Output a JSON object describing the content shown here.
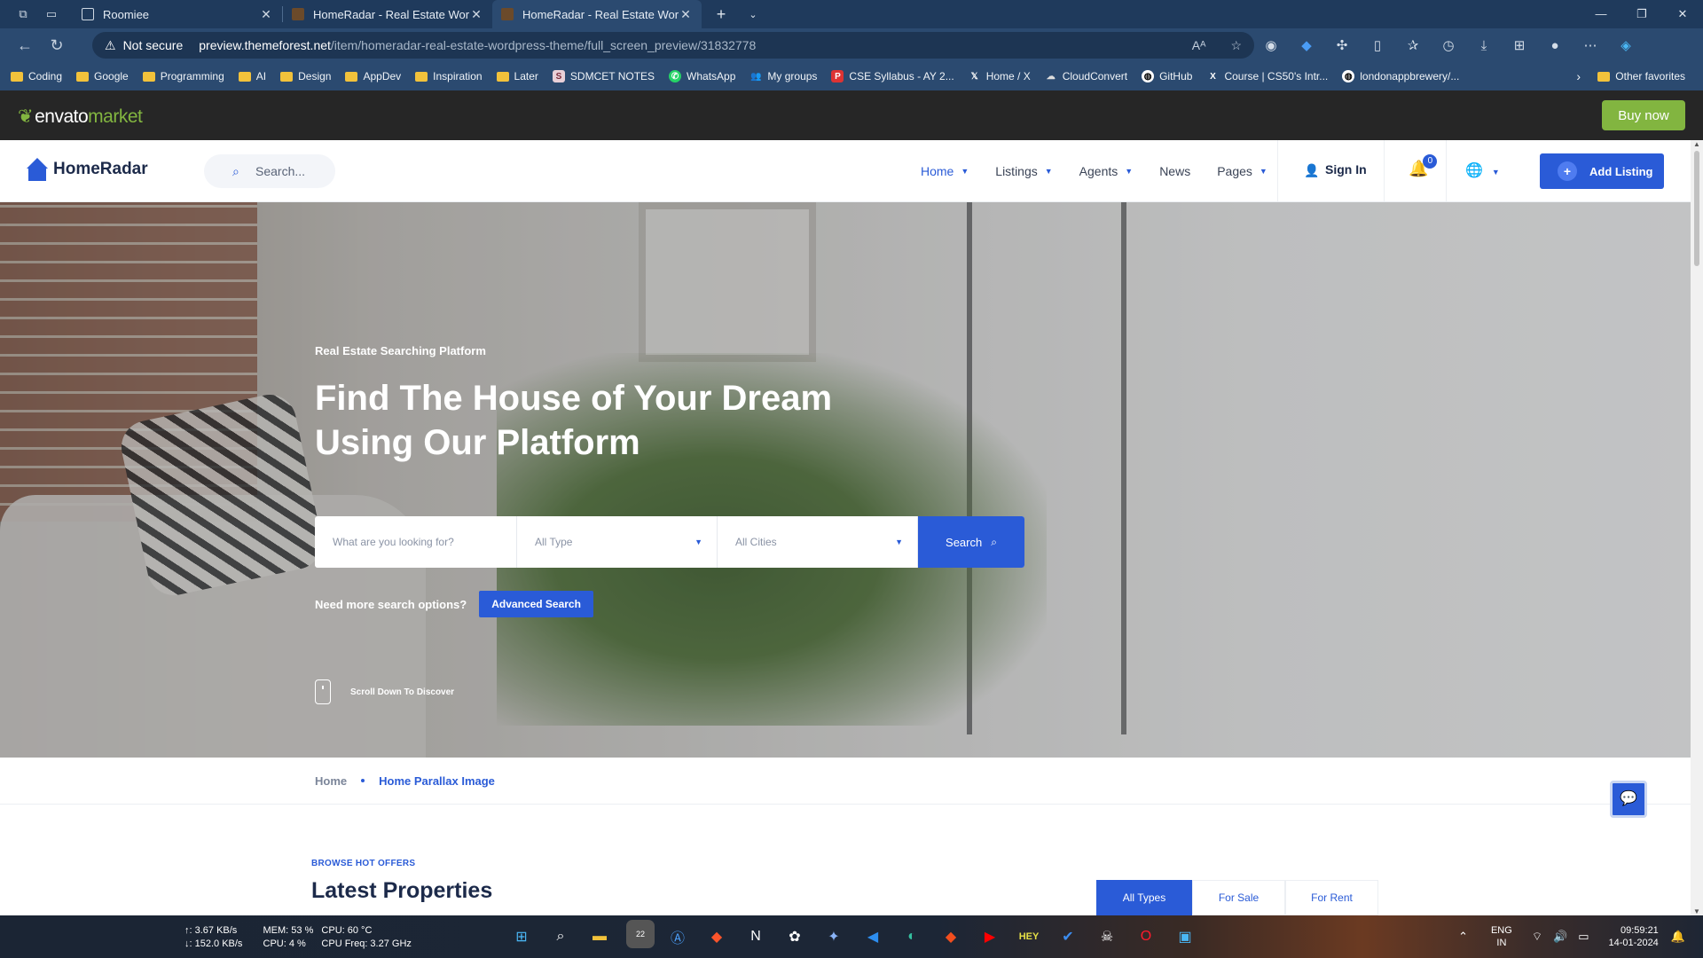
{
  "browser": {
    "tabs": [
      {
        "title": "Roomiee",
        "active": false
      },
      {
        "title": "HomeRadar - Real Estate WordPr",
        "active": false
      },
      {
        "title": "HomeRadar - Real Estate WordPr",
        "active": true
      }
    ],
    "address": {
      "security": "Not secure",
      "domain": "preview.themeforest.net",
      "path": "/item/homeradar-real-estate-wordpress-theme/full_screen_preview/31832778"
    },
    "bookmarks": [
      {
        "label": "Coding",
        "type": "folder"
      },
      {
        "label": "Google",
        "type": "folder"
      },
      {
        "label": "Programming",
        "type": "folder"
      },
      {
        "label": "AI",
        "type": "folder"
      },
      {
        "label": "Design",
        "type": "folder"
      },
      {
        "label": "AppDev",
        "type": "folder"
      },
      {
        "label": "Inspiration",
        "type": "folder"
      },
      {
        "label": "Later",
        "type": "folder"
      },
      {
        "label": "SDMCET NOTES",
        "type": "site"
      },
      {
        "label": "WhatsApp",
        "type": "site"
      },
      {
        "label": "My groups",
        "type": "site"
      },
      {
        "label": "CSE Syllabus - AY 2...",
        "type": "site"
      },
      {
        "label": "Home / X",
        "type": "site"
      },
      {
        "label": "CloudConvert",
        "type": "site"
      },
      {
        "label": "GitHub",
        "type": "site"
      },
      {
        "label": "Course | CS50's Intr...",
        "type": "site"
      },
      {
        "label": "londonappbrewery/...",
        "type": "site"
      }
    ],
    "other_favorites": "Other favorites"
  },
  "envato": {
    "logo_main": "envato",
    "logo_sub": "market",
    "buy_now": "Buy now"
  },
  "site": {
    "brand": "HomeRadar",
    "search_placeholder": "Search...",
    "menu": [
      {
        "label": "Home",
        "dropdown": true,
        "active": true
      },
      {
        "label": "Listings",
        "dropdown": true,
        "active": false
      },
      {
        "label": "Agents",
        "dropdown": true,
        "active": false
      },
      {
        "label": "News",
        "dropdown": false,
        "active": false
      },
      {
        "label": "Pages",
        "dropdown": true,
        "active": false
      }
    ],
    "sign_in": "Sign In",
    "notifications_count": "0",
    "add_listing": "Add Listing"
  },
  "hero": {
    "eyebrow": "Real Estate Searching Platform",
    "headline_line1": "Find The House of Your Dream",
    "headline_line2": "Using Our Platform",
    "search": {
      "query_placeholder": "What are you looking for?",
      "type_value": "All Type",
      "city_value": "All Cities",
      "button": "Search"
    },
    "more_options": "Need more search options?",
    "advanced_search": "Advanced Search",
    "scroll_hint": "Scroll Down To Discover"
  },
  "breadcrumb": {
    "home": "Home",
    "current": "Home Parallax Image"
  },
  "latest": {
    "eyebrow": "BROWSE HOT OFFERS",
    "title": "Latest Properties",
    "filters": [
      "All Types",
      "For Sale",
      "For Rent"
    ],
    "active_filter": "All Types"
  },
  "taskbar": {
    "net_up": "↑: 3.67 KB/s",
    "net_down": "↓: 152.0 KB/s",
    "mem": "MEM: 53 %",
    "cpu_temp": "CPU: 60 °C",
    "cpu": "CPU: 4 %",
    "cpu_freq": "CPU Freq: 3.27 GHz",
    "telegram_badge": "22",
    "lang_top": "ENG",
    "lang_bottom": "IN",
    "time": "09:59:21",
    "date": "14-01-2024"
  },
  "colors": {
    "accent": "#2a5bd7",
    "envato_green": "#82b540",
    "chrome": "#2b4a70"
  }
}
